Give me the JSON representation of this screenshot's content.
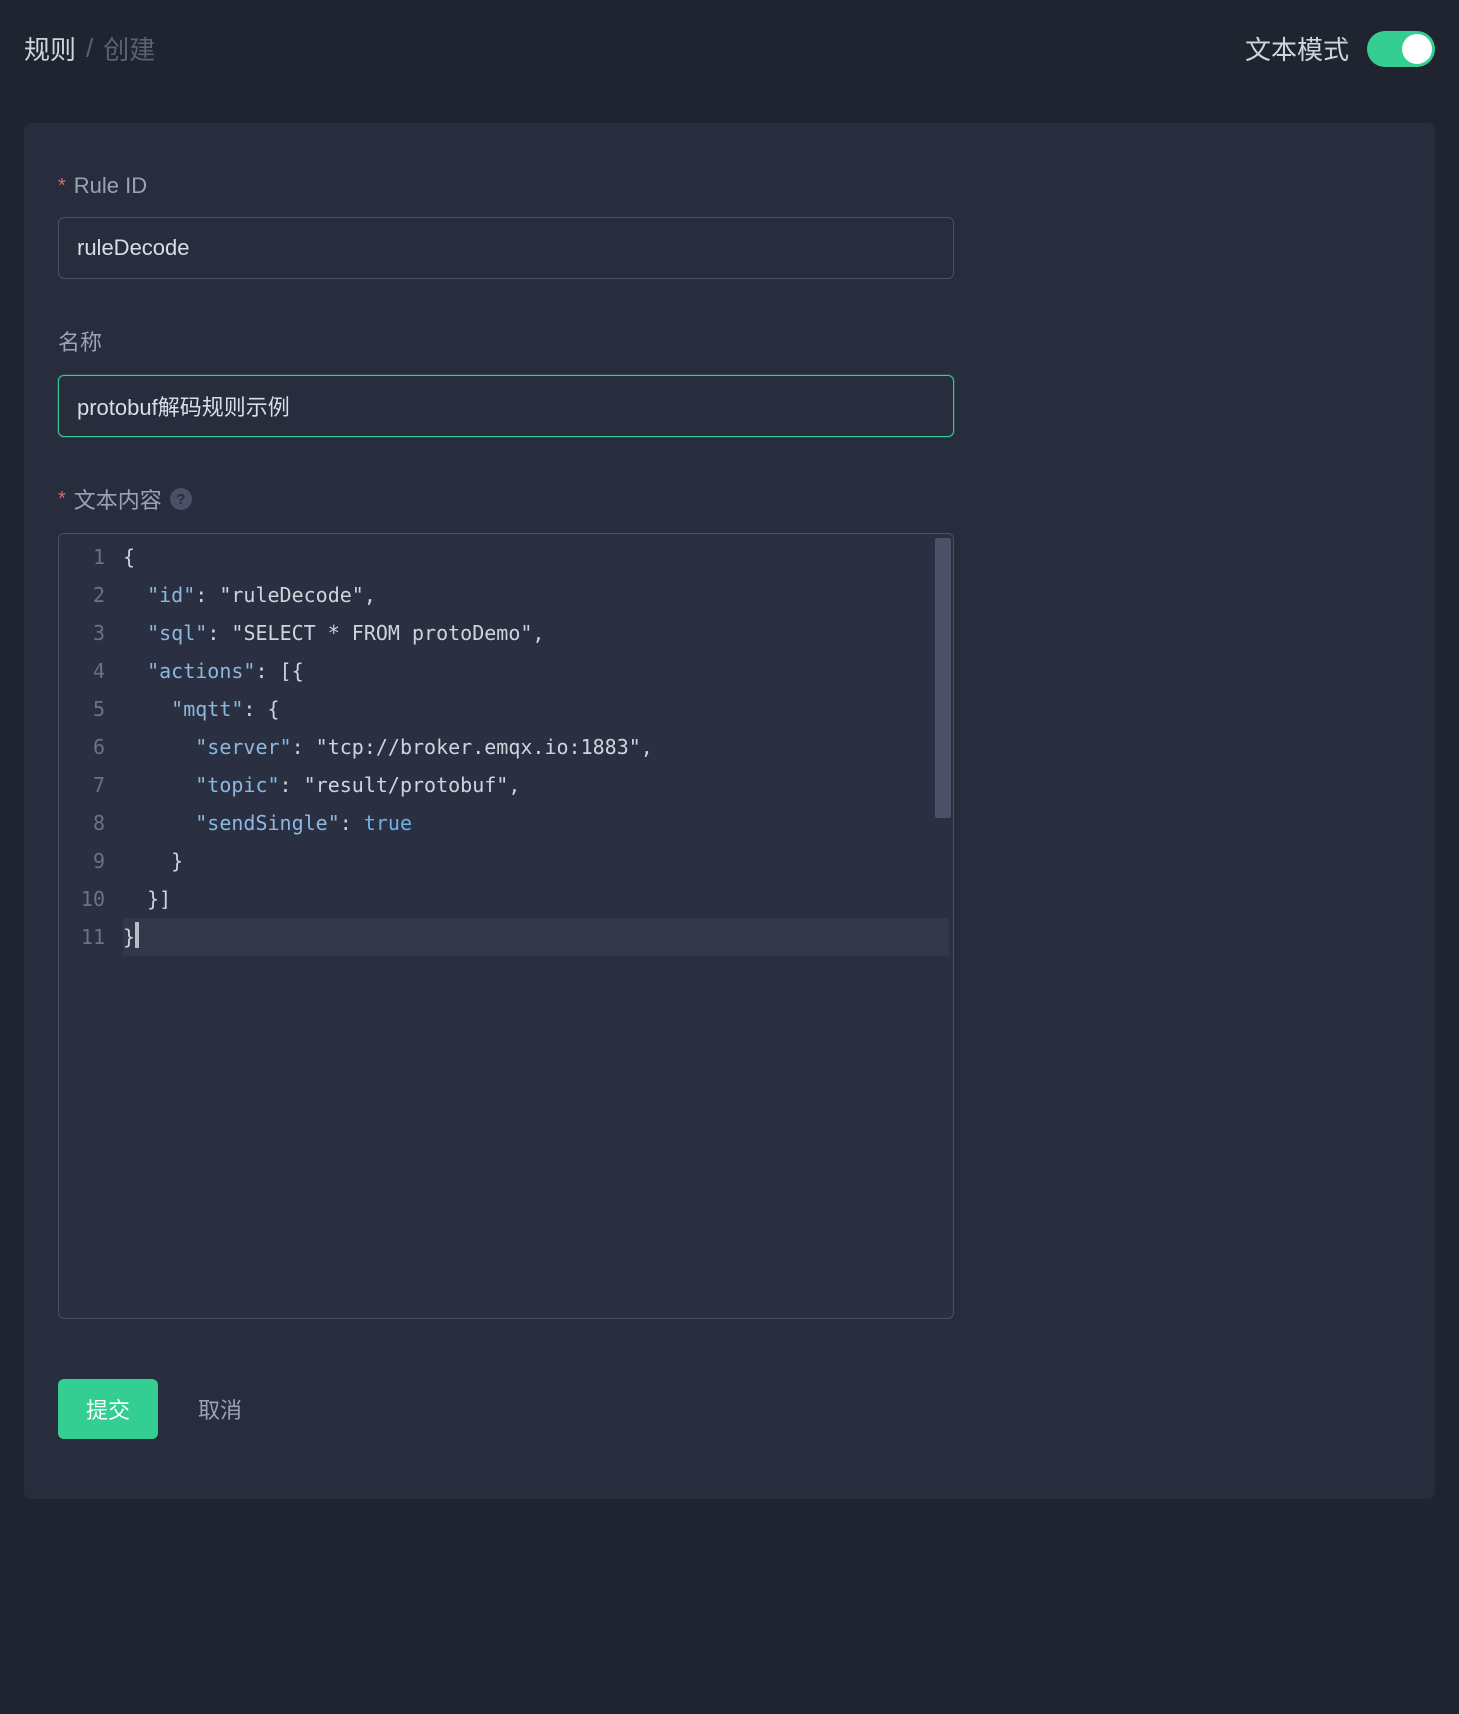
{
  "breadcrumb": {
    "root": "规则",
    "separator": "/",
    "current": "创建"
  },
  "header": {
    "mode_label": "文本模式",
    "toggle_on": true
  },
  "form": {
    "rule_id": {
      "label": "Rule ID",
      "required": true,
      "value": "ruleDecode"
    },
    "name": {
      "label": "名称",
      "required": false,
      "value": "protobuf解码规则示例"
    },
    "text_content": {
      "label": "文本内容",
      "required": true,
      "lines": [
        "1",
        "2",
        "3",
        "4",
        "5",
        "6",
        "7",
        "8",
        "9",
        "10",
        "11"
      ],
      "raw": "{\n  \"id\": \"ruleDecode\",\n  \"sql\": \"SELECT * FROM protoDemo\",\n  \"actions\": [{\n    \"mqtt\": {\n      \"server\": \"tcp://broker.emqx.io:1883\",\n      \"topic\": \"result/protobuf\",\n      \"sendSingle\": true\n    }\n  }]\n}"
    }
  },
  "actions": {
    "submit": "提交",
    "cancel": "取消"
  }
}
